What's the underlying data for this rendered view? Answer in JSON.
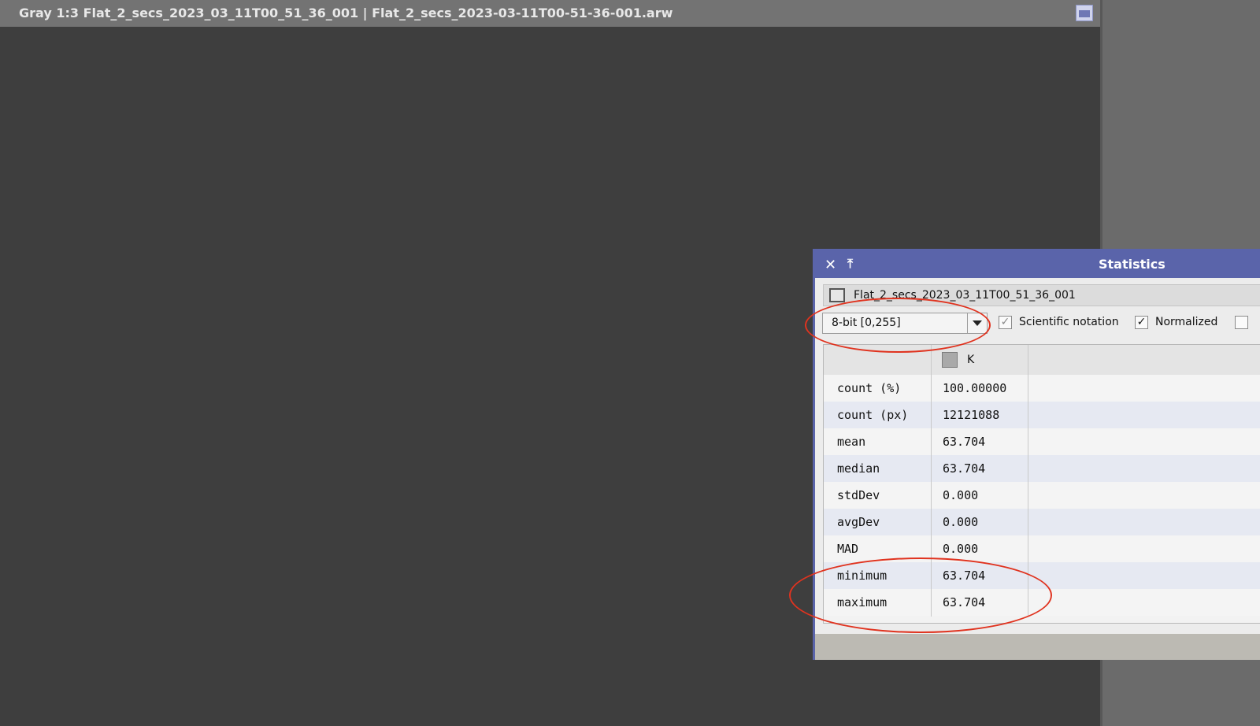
{
  "image_window": {
    "title": "Gray 1:3 Flat_2_secs_2023_03_11T00_51_36_001 | Flat_2_secs_2023-03-11T00-51-36-001.arw"
  },
  "statistics": {
    "title": "Statistics",
    "close_icon": "✕",
    "shade_icon": "⤒",
    "view_name": "Flat_2_secs_2023_03_11T00_51_36_001",
    "range_value": "8-bit [0,255]",
    "scientific_notation": {
      "label": "Scientific notation",
      "checked": true,
      "mark": "✓"
    },
    "normalized": {
      "label": "Normalized",
      "checked": true,
      "mark": "✓"
    },
    "channel": "K",
    "rows": [
      {
        "label": "count (%)",
        "value": "100.00000"
      },
      {
        "label": "count (px)",
        "value": "12121088"
      },
      {
        "label": "mean",
        "value": "63.704"
      },
      {
        "label": "median",
        "value": "63.704"
      },
      {
        "label": "stdDev",
        "value": "0.000"
      },
      {
        "label": "avgDev",
        "value": "0.000"
      },
      {
        "label": "MAD",
        "value": "0.000"
      },
      {
        "label": "minimum",
        "value": "63.704"
      },
      {
        "label": "maximum",
        "value": "63.704"
      }
    ]
  },
  "colors": {
    "dialog_accent": "#5a64aa",
    "annotation": "#e0331f",
    "workspace": "#3e3e3e"
  }
}
